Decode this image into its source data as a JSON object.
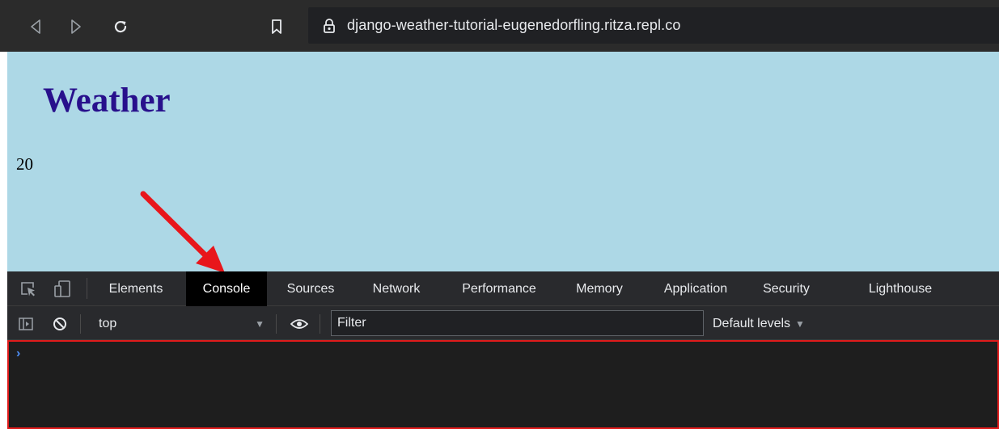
{
  "browser": {
    "url": "django-weather-tutorial-eugenedorfling.ritza.repl.co",
    "icons": {
      "back": "arrow-left-icon",
      "forward": "arrow-right-icon",
      "reload": "reload-icon",
      "bookmark": "bookmark-icon",
      "lock": "lock-icon"
    }
  },
  "page": {
    "title": "Weather",
    "value": "20",
    "background": "#add8e6",
    "title_color": "#28108c"
  },
  "devtools": {
    "tabs": [
      {
        "label": "Elements"
      },
      {
        "label": "Console",
        "active": true
      },
      {
        "label": "Sources"
      },
      {
        "label": "Network"
      },
      {
        "label": "Performance"
      },
      {
        "label": "Memory"
      },
      {
        "label": "Application"
      },
      {
        "label": "Security"
      },
      {
        "label": "Lighthouse"
      }
    ],
    "toolbar": {
      "context": "top",
      "filter_placeholder": "Filter",
      "levels": "Default levels"
    },
    "console": {
      "prompt": "›"
    },
    "highlight_color": "#e01b1b"
  },
  "annotation": {
    "arrow_color": "#e8161b"
  }
}
